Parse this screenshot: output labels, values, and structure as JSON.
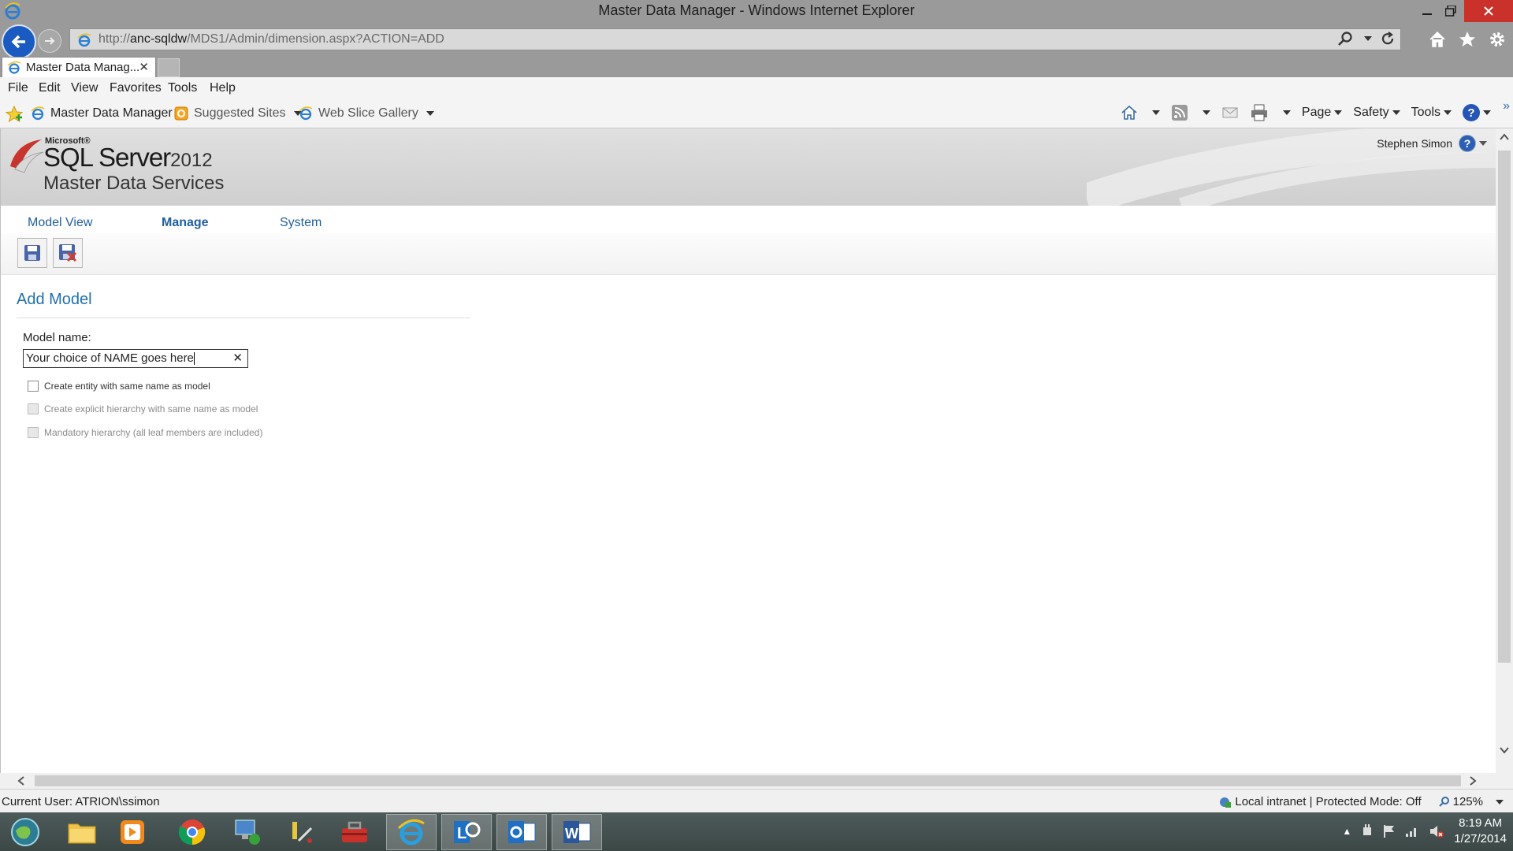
{
  "window": {
    "title": "Master Data Manager - Windows Internet Explorer"
  },
  "address_bar": {
    "url_prefix": "http://",
    "url_host": "anc-sqldw",
    "url_path": "/MDS1/Admin/dimension.aspx?ACTION=ADD"
  },
  "tabs": [
    {
      "label": "Master Data Manag..."
    }
  ],
  "menu": [
    "File",
    "Edit",
    "View",
    "Favorites",
    "Tools",
    "Help"
  ],
  "favorites_bar": {
    "items": [
      "Master Data Manager",
      "Suggested Sites",
      "Web Slice Gallery"
    ]
  },
  "command_bar": {
    "page_label": "Page",
    "safety_label": "Safety",
    "tools_label": "Tools"
  },
  "mds_header": {
    "microsoft": "Microsoft®",
    "product": "SQL Server",
    "version": "2012",
    "subtitle": "Master Data Services",
    "user": "Stephen Simon"
  },
  "nav_tabs": [
    {
      "label": "Model View"
    },
    {
      "label": "Manage"
    },
    {
      "label": "System"
    }
  ],
  "form": {
    "title": "Add Model",
    "model_name_label": "Model name:",
    "model_name_value": "Your choice of NAME goes here",
    "checkboxes": [
      {
        "label": "Create entity with same name as model",
        "enabled": true,
        "checked": false
      },
      {
        "label": "Create explicit hierarchy with same name as model",
        "enabled": false,
        "checked": false
      },
      {
        "label": "Mandatory hierarchy (all leaf members are included)",
        "enabled": false,
        "checked": false
      }
    ]
  },
  "status_bar": {
    "current_user": "Current User: ATRION\\ssimon",
    "zone": "Local intranet | Protected Mode: Off",
    "zoom": "125%"
  },
  "taskbar": {
    "time": "8:19 AM",
    "date": "1/27/2014"
  },
  "colors": {
    "accent_blue": "#1f6fae",
    "close_red": "#c9312a",
    "chrome_gray": "#9a9a9a"
  }
}
